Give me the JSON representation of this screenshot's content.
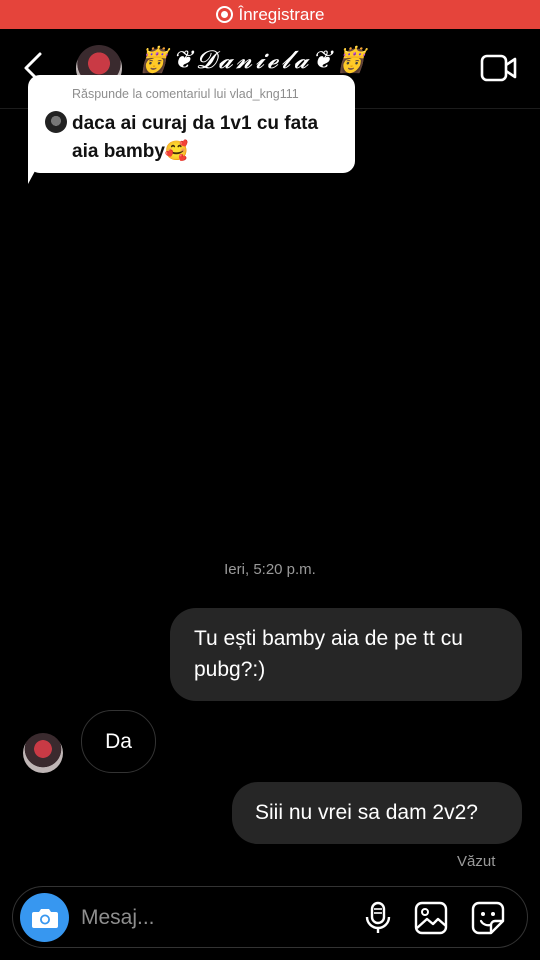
{
  "status_bar": {
    "recording_label": "Înregistrare",
    "accent_color": "#e5443b"
  },
  "header": {
    "contact_name": "👸❦𝓓𝓪𝓷𝓲𝓮𝓵𝓪❦👸",
    "back_icon": "chevron-left-icon",
    "video_icon": "video-camera-icon"
  },
  "reply_card": {
    "header_text": "Răspunde la comentariul lui vlad_kng111",
    "comment_text": "daca ai curaj da 1v1 cu fata aia bamby🥰"
  },
  "conversation": {
    "timestamp": "Ieri, 5:20 p.m.",
    "messages": [
      {
        "direction": "outgoing",
        "text": "Tu ești bamby aia de pe tt cu pubg?:)"
      },
      {
        "direction": "incoming",
        "text": "Da"
      },
      {
        "direction": "outgoing",
        "text": "Siii nu vrei sa dam 2v2?"
      }
    ],
    "seen_label": "Văzut"
  },
  "composer": {
    "placeholder": "Mesaj...",
    "camera_color": "#3797f0",
    "icons": [
      "camera-icon",
      "microphone-icon",
      "gallery-icon",
      "sticker-icon"
    ]
  }
}
